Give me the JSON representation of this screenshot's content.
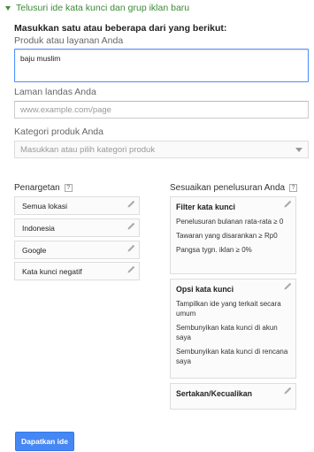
{
  "header": {
    "title": "Telusuri ide kata kunci dan grup iklan baru"
  },
  "instruction": "Masukkan satu atau beberapa dari yang berikut:",
  "product": {
    "label": "Produk atau layanan Anda",
    "value": "baju muslim"
  },
  "landing": {
    "label": "Laman landas Anda",
    "placeholder": "www.example.com/page"
  },
  "category": {
    "label": "Kategori produk Anda",
    "placeholder": "Masukkan atau pilih kategori produk"
  },
  "targeting": {
    "title": "Penargetan",
    "help": "?",
    "items": [
      "Semua lokasi",
      "Indonesia",
      "Google",
      "Kata kunci negatif"
    ]
  },
  "customize": {
    "title": "Sesuaikan penelusuran Anda",
    "help": "?",
    "filter": {
      "heading": "Filter kata kunci",
      "lines": [
        "Penelusuran bulanan rata-rata ≥ 0",
        "Tawaran yang disarankan ≥ Rp0",
        "Pangsa tygn. iklan ≥ 0%"
      ]
    },
    "options": {
      "heading": "Opsi kata kunci",
      "lines": [
        "Tampilkan ide yang terkait secara umum",
        "Sembunyikan kata kunci di akun saya",
        "Sembunyikan kata kunci di rencana saya"
      ]
    },
    "include": {
      "heading": "Sertakan/Kecualikan"
    }
  },
  "submit_label": "Dapatkan ide",
  "colors": {
    "accent": "#3d8a36",
    "button": "#4687f4",
    "focus_border": "#4d90fe"
  }
}
